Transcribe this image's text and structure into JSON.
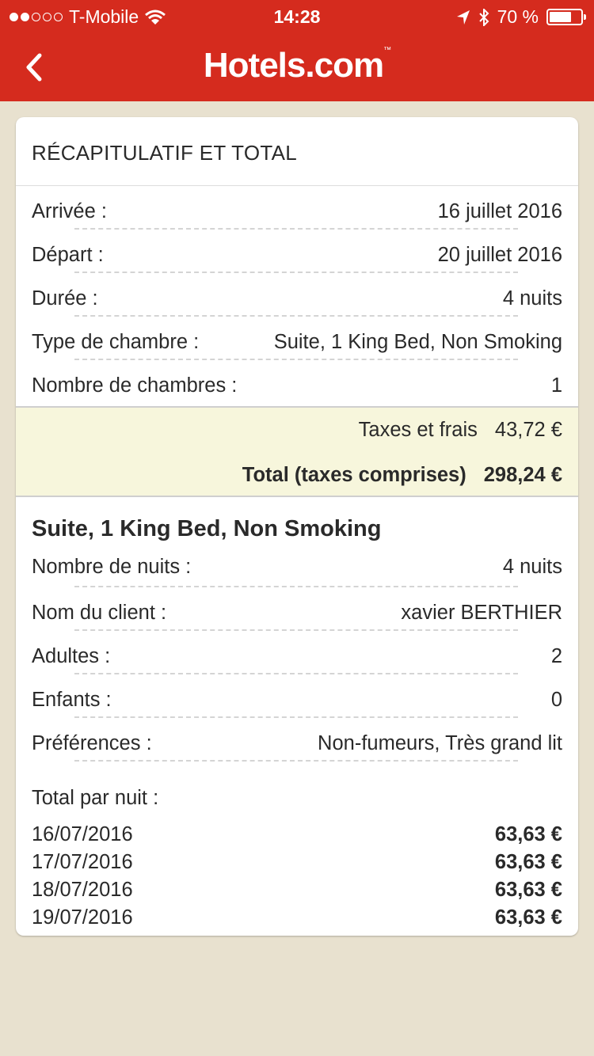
{
  "status_bar": {
    "carrier": "T-Mobile",
    "signal_bars": 2,
    "time": "14:28",
    "battery_percent": "70 %",
    "battery_level": 0.7
  },
  "header": {
    "brand": "Hotels.com",
    "brand_tm": "™",
    "color": "#d52b1e"
  },
  "summary": {
    "title": "RÉCAPITULATIF ET TOTAL",
    "rows": [
      {
        "label": "Arrivée :",
        "value": "16 juillet 2016"
      },
      {
        "label": "Départ :",
        "value": "20 juillet 2016"
      },
      {
        "label": "Durée :",
        "value": "4 nuits"
      },
      {
        "label": "Type de chambre :",
        "value": "Suite, 1 King Bed, Non Smoking"
      },
      {
        "label": "Nombre de chambres :",
        "value": "1"
      }
    ],
    "taxes_label": "Taxes et frais",
    "taxes_value": "43,72 €",
    "total_label": "Total (taxes comprises)",
    "total_value": "298,24 €"
  },
  "room": {
    "title": "Suite, 1 King Bed, Non Smoking",
    "rows": [
      {
        "label": "Nombre de nuits :",
        "value": "4 nuits"
      },
      {
        "label": "Nom du client :",
        "value": "xavier BERTHIER"
      },
      {
        "label": "Adultes :",
        "value": "2"
      },
      {
        "label": "Enfants :",
        "value": "0"
      },
      {
        "label": "Préférences :",
        "value": "Non-fumeurs, Très grand lit"
      }
    ],
    "per_night_label": "Total par nuit :",
    "nights": [
      {
        "date": "16/07/2016",
        "price": "63,63 €"
      },
      {
        "date": "17/07/2016",
        "price": "63,63 €"
      },
      {
        "date": "18/07/2016",
        "price": "63,63 €"
      },
      {
        "date": "19/07/2016",
        "price": "63,63 €"
      }
    ]
  }
}
